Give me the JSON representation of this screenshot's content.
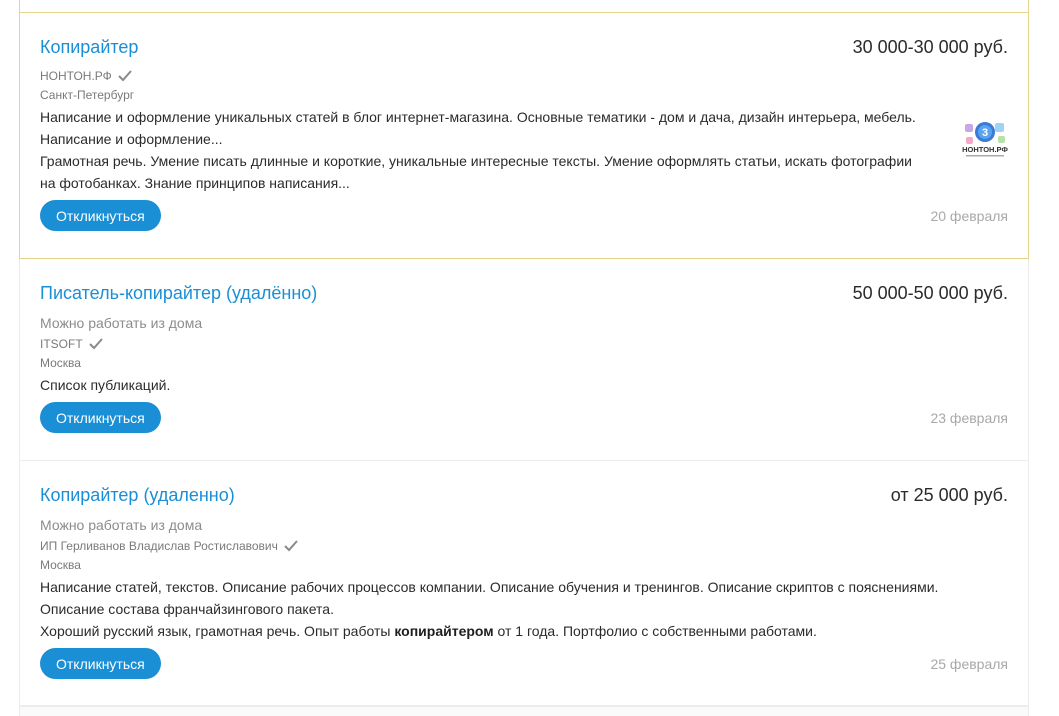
{
  "vacancies": [
    {
      "title": "Копирайтер",
      "salary": "30 000-30 000 руб.",
      "employer": "НОНТОН.РФ",
      "city": "Санкт-Петербург",
      "desc_lines": [
        "Написание и оформление уникальных статей в блог интернет-магазина. Основные тематики - дом и дача, дизайн интерьера, мебель.",
        "Написание и оформление...",
        "Грамотная речь. Умение писать длинные и короткие, уникальные интересные тексты. Умение оформлять статьи, искать фотографии",
        "на фотобанках. Знание принципов написания..."
      ],
      "button": "Откликнуться",
      "date": "20 февраля",
      "logo_text": "НОНТОН.РФ"
    },
    {
      "title": "Писатель-копирайтер (удалённо)",
      "salary": "50 000-50 000 руб.",
      "remote": "Можно работать из дома",
      "employer": "ITSOFT",
      "city": "Москва",
      "desc_lines": [
        "Список публикаций."
      ],
      "button": "Откликнуться",
      "date": "23 февраля"
    },
    {
      "title": "Копирайтер (удаленно)",
      "salary": "от 25 000 руб.",
      "remote": "Можно работать из дома",
      "employer": "ИП Герливанов Владислав Ростиславович",
      "city": "Москва",
      "desc_lines": [
        "Написание статей, текстов. Описание рабочих процессов компании. Описание обучения и тренингов. Описание скриптов с пояснениями.",
        "Описание состава франчайзингового пакета."
      ],
      "desc_last": {
        "before": "Хороший русский язык, грамотная речь. Опыт работы ",
        "bold": "копирайтером",
        "after": " от 1 года. Портфолио с собственными работами."
      },
      "button": "Откликнуться",
      "date": "25 февраля"
    }
  ],
  "colors": {
    "link": "#1a8fd6",
    "button_bg": "#1a8fd6",
    "highlight_border": "#e6d48a",
    "muted": "#a8a8a8"
  },
  "icons": {
    "verified": "checkmark-icon",
    "logo": "nonton-logo"
  }
}
